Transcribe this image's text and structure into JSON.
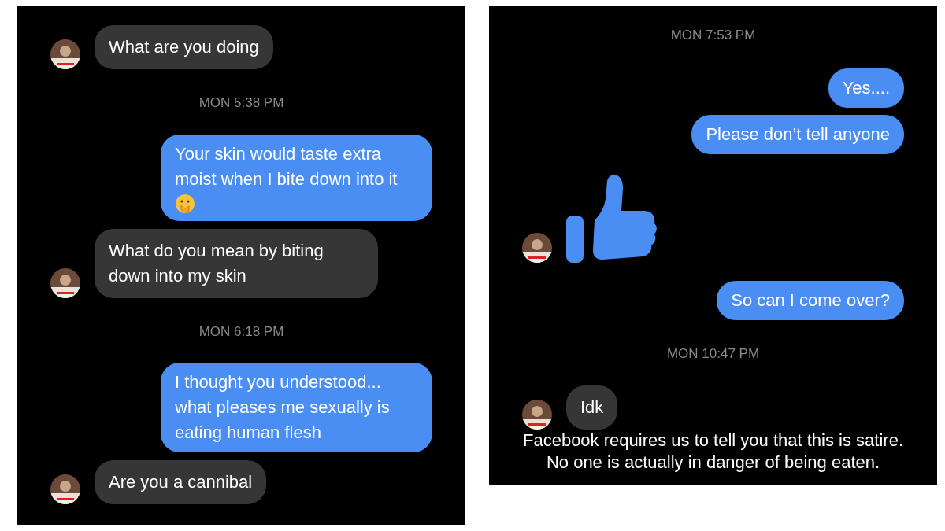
{
  "panels": [
    {
      "items": [
        {
          "kind": "incoming",
          "text": "What are you doing",
          "avatar": true
        },
        {
          "kind": "timestamp",
          "text": "MON 5:38 PM"
        },
        {
          "kind": "outgoing",
          "text": "Your skin would taste extra moist when I bite down into it",
          "emoji": true
        },
        {
          "kind": "incoming",
          "text": "What do you mean by biting down into my skin",
          "avatar": true
        },
        {
          "kind": "timestamp",
          "text": "MON 6:18 PM"
        },
        {
          "kind": "outgoing",
          "text": "I thought you understood... what pleases me sexually is eating human flesh",
          "emoji": false
        },
        {
          "kind": "incoming",
          "text": "Are you a cannibal",
          "avatar": true
        }
      ]
    },
    {
      "items": [
        {
          "kind": "timestamp",
          "text": "MON 7:53 PM"
        },
        {
          "kind": "outgoing",
          "text": "Yes....",
          "emoji": false
        },
        {
          "kind": "outgoing",
          "text": "Please don’t tell anyone",
          "emoji": false
        },
        {
          "kind": "like",
          "avatar": true
        },
        {
          "kind": "outgoing",
          "text": "So can I come over?",
          "emoji": false
        },
        {
          "kind": "timestamp",
          "text": "MON 10:47 PM"
        },
        {
          "kind": "incoming",
          "text": "Idk",
          "avatar": true
        }
      ],
      "footer": [
        "Facebook requires us to tell you that this is satire.",
        "No one is actually in danger of being eaten."
      ]
    }
  ]
}
